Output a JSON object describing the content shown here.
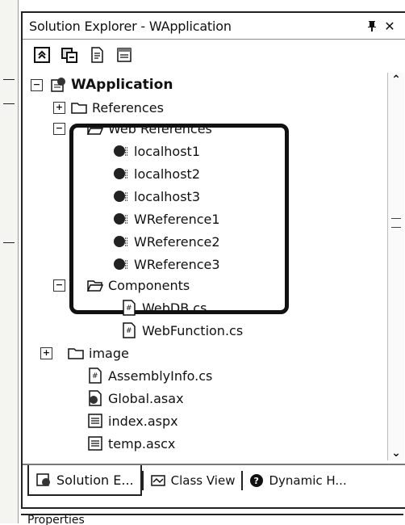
{
  "window": {
    "title": "Solution Explorer - WApplication",
    "pin_icon": "pin-icon",
    "close_icon": "close-icon"
  },
  "toolbar": {
    "buttons": [
      "properties-icon",
      "refresh-icon",
      "view-code-icon",
      "view-designer-icon"
    ]
  },
  "tree": {
    "root": {
      "label": "WApplication"
    },
    "references": {
      "label": "References"
    },
    "web_references": {
      "label": "Web References",
      "items": [
        "localhost1",
        "localhost2",
        "localhost3",
        "WReference1",
        "WReference2",
        "WReference3"
      ]
    },
    "components": {
      "label": "Components",
      "items": [
        "WebDB.cs",
        "WebFunction.cs"
      ]
    },
    "image": {
      "label": "image"
    },
    "files": [
      "AssemblyInfo.cs",
      "Global.asax",
      "index.aspx",
      "temp.ascx"
    ]
  },
  "tabs": {
    "solution": "Solution E...",
    "class_view": "Class View",
    "dynamic_help": "Dynamic H..."
  },
  "properties": {
    "title": "Properties"
  },
  "colors": {
    "border": "#222222",
    "background": "#ffffff"
  }
}
